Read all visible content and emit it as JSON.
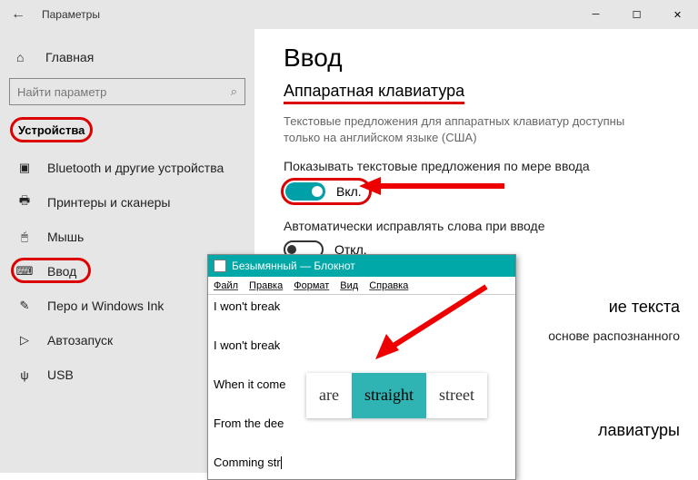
{
  "titlebar": {
    "title": "Параметры"
  },
  "sidebar": {
    "home": "Главная",
    "search_placeholder": "Найти параметр",
    "category": "Устройства",
    "items": [
      {
        "icon": "bt",
        "label": "Bluetooth и другие устройства"
      },
      {
        "icon": "prn",
        "label": "Принтеры и сканеры"
      },
      {
        "icon": "mouse",
        "label": "Мышь"
      },
      {
        "icon": "kb",
        "label": "Ввод",
        "highlight": true
      },
      {
        "icon": "pen",
        "label": "Перо и Windows Ink"
      },
      {
        "icon": "auto",
        "label": "Автозапуск"
      },
      {
        "icon": "usb",
        "label": "USB"
      }
    ]
  },
  "main": {
    "heading": "Ввод",
    "subheading": "Аппаратная клавиатура",
    "description": "Текстовые предложения для аппаратных клавиатур доступны только на английском языке (США)",
    "opt1": {
      "label": "Показывать текстовые предложения по мере ввода",
      "state": "Вкл."
    },
    "opt2": {
      "label": "Автоматически исправлять слова при вводе",
      "state": "Откл."
    },
    "peek_heading_1": "ие текста",
    "peek_text": "основе распознанного",
    "peek_heading_2": "лавиатуры"
  },
  "notepad": {
    "title": "Безымянный — Блокнот",
    "menu": [
      "Файл",
      "Правка",
      "Формат",
      "Вид",
      "Справка"
    ],
    "lines": [
      "I won't break",
      "",
      "I won't break",
      "",
      "When it come",
      "",
      "From the dee",
      "",
      "Comming str"
    ],
    "suggestions": [
      "are",
      "straight",
      "street"
    ],
    "selected": 1
  }
}
